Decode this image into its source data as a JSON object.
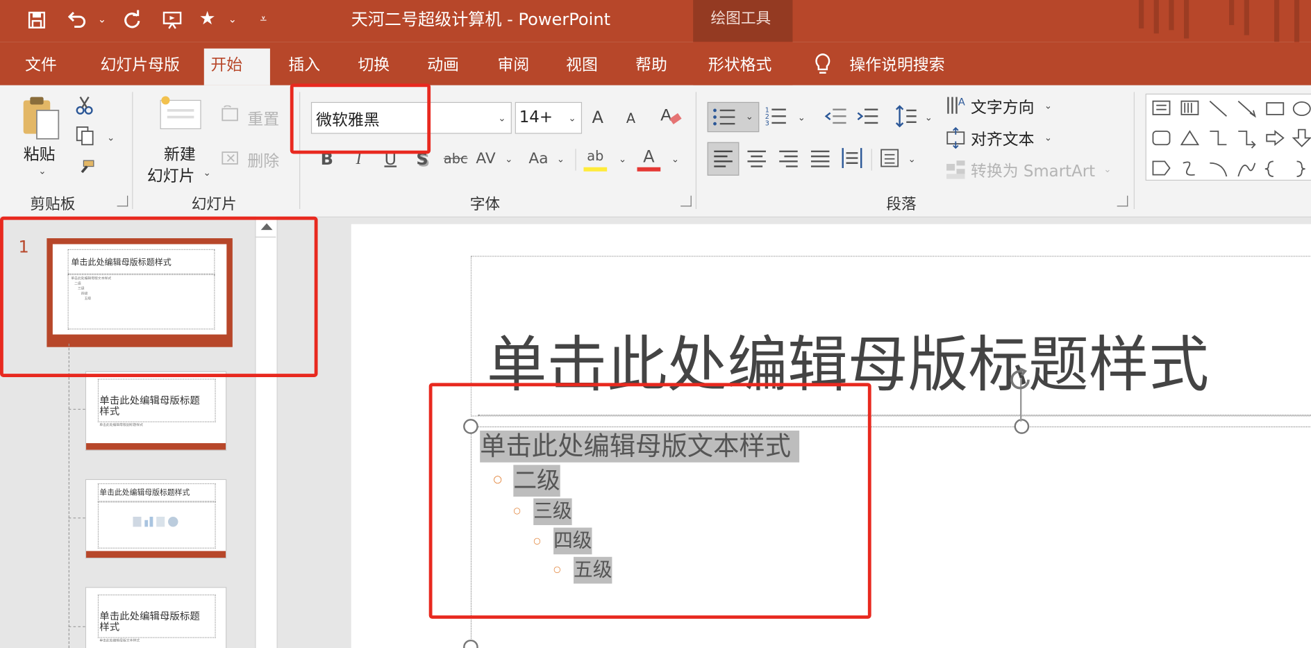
{
  "window": {
    "title": "天河二号超级计算机 - PowerPoint",
    "context_label": "绘图工具",
    "accent": "#b7472a"
  },
  "quick_access": [
    {
      "icon": "save-icon"
    },
    {
      "icon": "undo-icon"
    },
    {
      "icon": "redo-icon"
    },
    {
      "icon": "present-icon"
    },
    {
      "icon": "star-icon"
    },
    {
      "icon": "customize-icon"
    }
  ],
  "tabs": [
    "文件",
    "幻灯片母版",
    "开始",
    "插入",
    "切换",
    "动画",
    "审阅",
    "视图",
    "帮助",
    "形状格式",
    "操作说明搜索"
  ],
  "ribbon": {
    "clipboard": {
      "paste": "粘贴",
      "label": "剪贴板"
    },
    "slides": {
      "new_slide_line1": "新建",
      "new_slide_line2": "幻灯片",
      "reset": "重置",
      "delete": "删除",
      "label": "幻灯片"
    },
    "font": {
      "name": "微软雅黑",
      "size": "14+",
      "grow": "A",
      "shrink": "A",
      "bold": "B",
      "italic": "I",
      "underline": "U",
      "shadow": "S",
      "strike": "abc",
      "spacing": "AV",
      "case": "Aa",
      "highlight": "ab",
      "color": "A",
      "label": "字体"
    },
    "paragraph": {
      "text_direction": "文字方向",
      "align_text": "对齐文本",
      "smartart": "转换为 SmartArt",
      "label": "段落"
    }
  },
  "thumbnails": {
    "master_number": "1",
    "master_title": "单击此处编辑母版标题样式",
    "layout1_title": "单击此处编辑母版标题样式",
    "layout2_title": "单击此处编辑母版标题样式",
    "layout3_title": "单击此处编辑母版标题样式"
  },
  "slide": {
    "title": "单击此处编辑母版标题样式",
    "body": {
      "level1": "单击此处编辑母版文本样式",
      "level2": "二级",
      "level3": "三级",
      "level4": "四级",
      "level5": "五级"
    }
  }
}
